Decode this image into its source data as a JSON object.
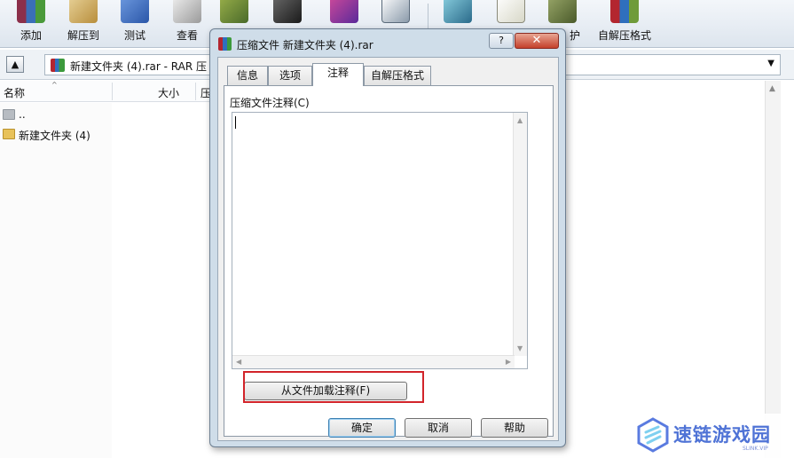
{
  "toolbar": {
    "items": [
      {
        "label": "添加",
        "icon": "add-archive-icon",
        "color": "#8b4a6b"
      },
      {
        "label": "解压到",
        "icon": "extract-to-icon",
        "color": "#c8a55a"
      },
      {
        "label": "测试",
        "icon": "test-icon",
        "color": "#3d6fc0"
      },
      {
        "label": "查看",
        "icon": "view-icon",
        "color": "#8a8a8a"
      },
      {
        "label": "",
        "icon": "delete-icon",
        "color": "#6b7f3c"
      },
      {
        "label": "",
        "icon": "find-icon",
        "color": "#3a3a3a"
      },
      {
        "label": "",
        "icon": "wizard-icon",
        "color": "#8a3ea8"
      },
      {
        "label": "",
        "icon": "info-icon",
        "color": "#5a6a7a"
      },
      {
        "label": "",
        "icon": "repair-icon",
        "color": "#3a8a9a"
      },
      {
        "label": "",
        "icon": "comment-icon",
        "color": "#e0e0d0"
      },
      {
        "label": "护",
        "icon": "protect-icon",
        "color": "#6a7a4a"
      },
      {
        "label": "自解压格式",
        "icon": "sfx-icon",
        "color": "#6f9b3a"
      }
    ]
  },
  "addressbar": {
    "path": "新建文件夹 (4).rar - RAR 压"
  },
  "filelist": {
    "columns": [
      "名称",
      "大小",
      "压"
    ],
    "rows": [
      {
        "name": ".."
      },
      {
        "name": "新建文件夹 (4)"
      }
    ]
  },
  "dialog": {
    "title": "压缩文件 新建文件夹 (4).rar",
    "help_label": "?",
    "close_label": "✕",
    "tabs": [
      "信息",
      "选项",
      "注释",
      "自解压格式"
    ],
    "active_tab": "注释",
    "comment_label": "压缩文件注释(C)",
    "comment_value": "",
    "load_button": "从文件加载注释(F)",
    "ok_button": "确定",
    "cancel_button": "取消",
    "help_button": "帮助"
  },
  "watermark": {
    "text": "速链游戏园",
    "sub": "SLINK.VIP"
  },
  "colors": {
    "highlight": "#d2242a",
    "dialog_frame": "#cfdde9",
    "close_button": "#c4402a"
  }
}
